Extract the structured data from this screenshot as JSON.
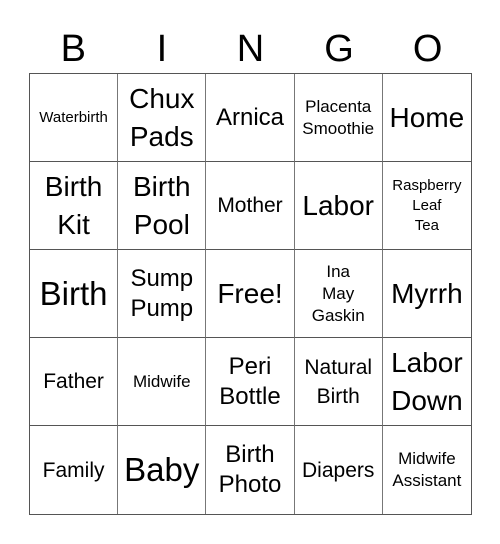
{
  "header": {
    "letters": [
      "B",
      "I",
      "N",
      "G",
      "O"
    ]
  },
  "board": {
    "rows": [
      [
        "Waterbirth",
        "Chux\nPads",
        "Arnica",
        "Placenta\nSmoothie",
        "Home"
      ],
      [
        "Birth\nKit",
        "Birth\nPool",
        "Mother",
        "Labor",
        "Raspberry\nLeaf\nTea"
      ],
      [
        "Birth",
        "Sump\nPump",
        "Free!",
        "Ina\nMay\nGaskin",
        "Myrrh"
      ],
      [
        "Father",
        "Midwife",
        "Peri\nBottle",
        "Natural\nBirth",
        "Labor\nDown"
      ],
      [
        "Family",
        "Baby",
        "Birth\nPhoto",
        "Diapers",
        "Midwife\nAssistant"
      ]
    ]
  }
}
